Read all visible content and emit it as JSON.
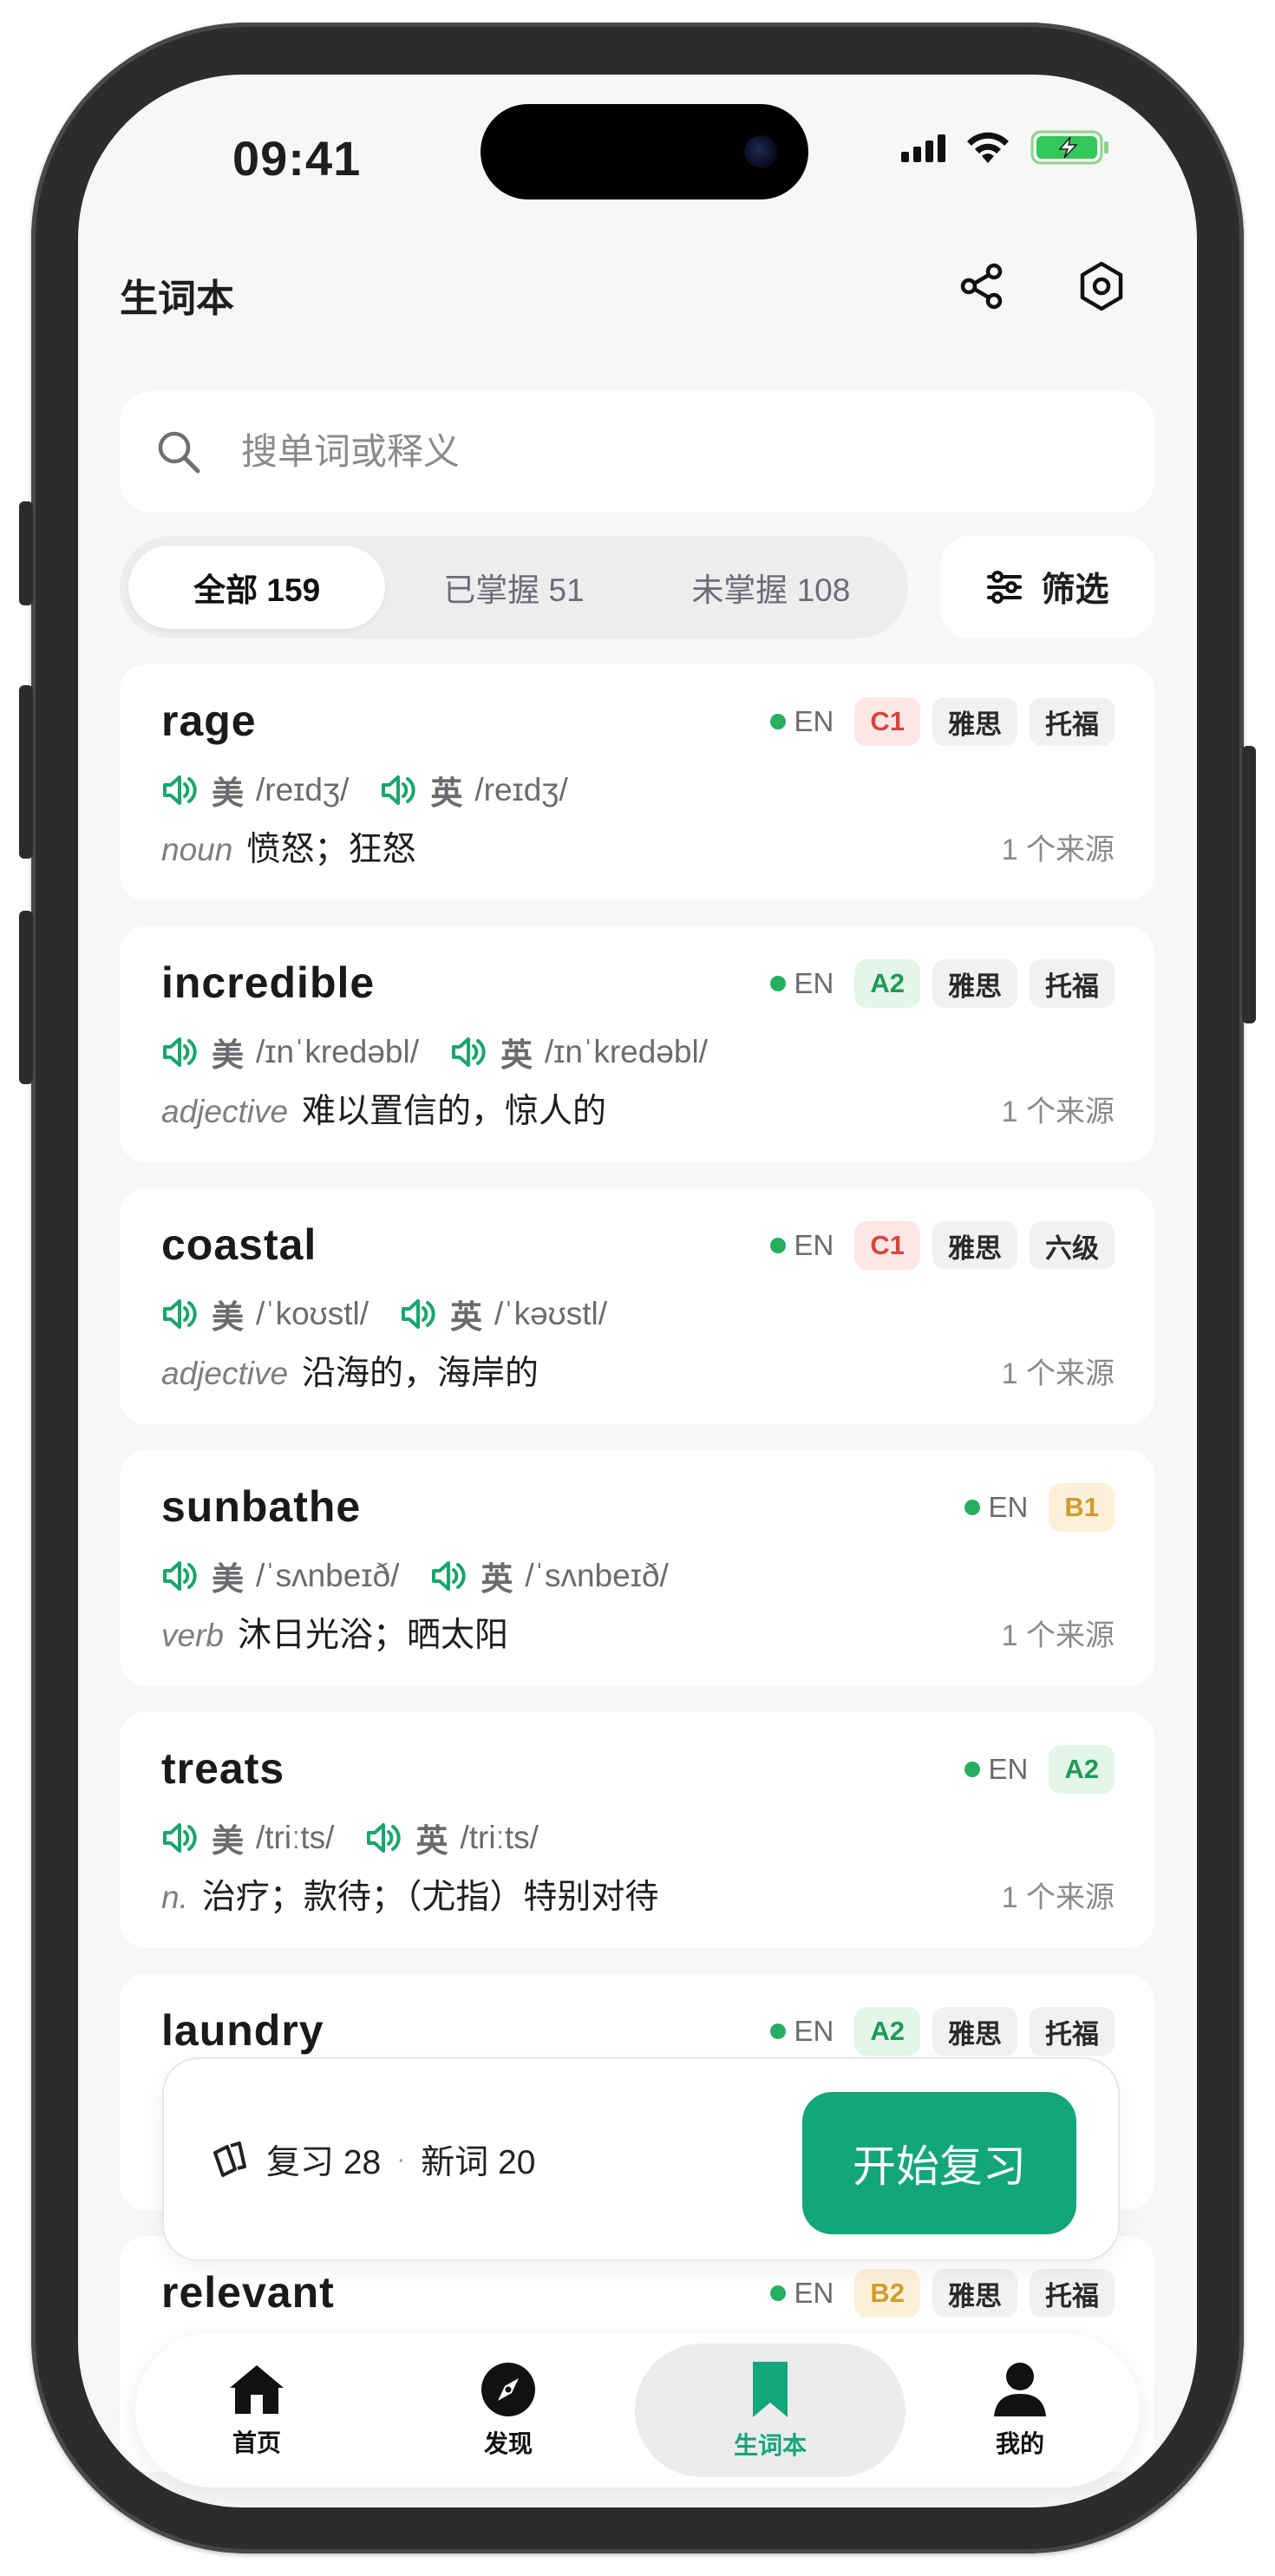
{
  "status_bar": {
    "time": "09:41"
  },
  "header": {
    "title": "生词本",
    "share_icon": "share-icon",
    "settings_icon": "settings-hex-icon"
  },
  "search": {
    "placeholder": "搜单词或释义"
  },
  "segments": [
    {
      "label": "全部 159",
      "active": true
    },
    {
      "label": "已掌握 51",
      "active": false
    },
    {
      "label": "未掌握 108",
      "active": false
    }
  ],
  "filter": {
    "label": "筛选"
  },
  "words": [
    {
      "word": "rage",
      "lang": "EN",
      "level": "C1",
      "exams": [
        "雅思",
        "托福"
      ],
      "us_label": "美",
      "us": "/reɪdʒ/",
      "uk_label": "英",
      "uk": "/reɪdʒ/",
      "pos": "noun",
      "def": "愤怒；狂怒",
      "sources": "1 个来源"
    },
    {
      "word": "incredible",
      "lang": "EN",
      "level": "A2",
      "exams": [
        "雅思",
        "托福"
      ],
      "us_label": "美",
      "us": "/ɪnˈkredəbl/",
      "uk_label": "英",
      "uk": "/ɪnˈkredəbl/",
      "pos": "adjective",
      "def": "难以置信的，惊人的",
      "sources": "1 个来源"
    },
    {
      "word": "coastal",
      "lang": "EN",
      "level": "C1",
      "exams": [
        "雅思",
        "六级"
      ],
      "us_label": "美",
      "us": "/ˈkoʊstl/",
      "uk_label": "英",
      "uk": "/ˈkəʊstl/",
      "pos": "adjective",
      "def": "沿海的，海岸的",
      "sources": "1 个来源"
    },
    {
      "word": "sunbathe",
      "lang": "EN",
      "level": "B1",
      "exams": [],
      "us_label": "美",
      "us": "/ˈsʌnbeɪð/",
      "uk_label": "英",
      "uk": "/ˈsʌnbeɪð/",
      "pos": "verb",
      "def": "沐日光浴；晒太阳",
      "sources": "1 个来源"
    },
    {
      "word": "treats",
      "lang": "EN",
      "level": "A2",
      "exams": [],
      "us_label": "美",
      "us": "/triːts/",
      "uk_label": "英",
      "uk": "/triːts/",
      "pos": "n.",
      "def": "治疗；款待；（尤指）特别对待",
      "sources": "1 个来源"
    },
    {
      "word": "laundry",
      "lang": "EN",
      "level": "A2",
      "exams": [
        "雅思",
        "托福"
      ],
      "us_label": "",
      "us": "",
      "uk_label": "",
      "uk": "",
      "pos": "",
      "def": "",
      "sources": ""
    },
    {
      "word": "relevant",
      "lang": "EN",
      "level": "B2",
      "exams": [
        "雅思",
        "托福"
      ],
      "us_label": "",
      "us": "",
      "uk_label": "",
      "uk": "",
      "pos": "",
      "def": "",
      "sources": ""
    }
  ],
  "review": {
    "review_label": "复习 28",
    "dot": "·",
    "new_label": "新词 20",
    "start_label": "开始复习"
  },
  "tabbar": [
    {
      "label": "首页",
      "icon": "home-icon",
      "active": false
    },
    {
      "label": "发现",
      "icon": "compass-icon",
      "active": false
    },
    {
      "label": "生词本",
      "icon": "bookmark-icon",
      "active": true
    },
    {
      "label": "我的",
      "icon": "person-icon",
      "active": false
    }
  ],
  "colors": {
    "accent": "#13a67a",
    "tab_active": "#13a67a",
    "background": "#f6f7f8"
  }
}
